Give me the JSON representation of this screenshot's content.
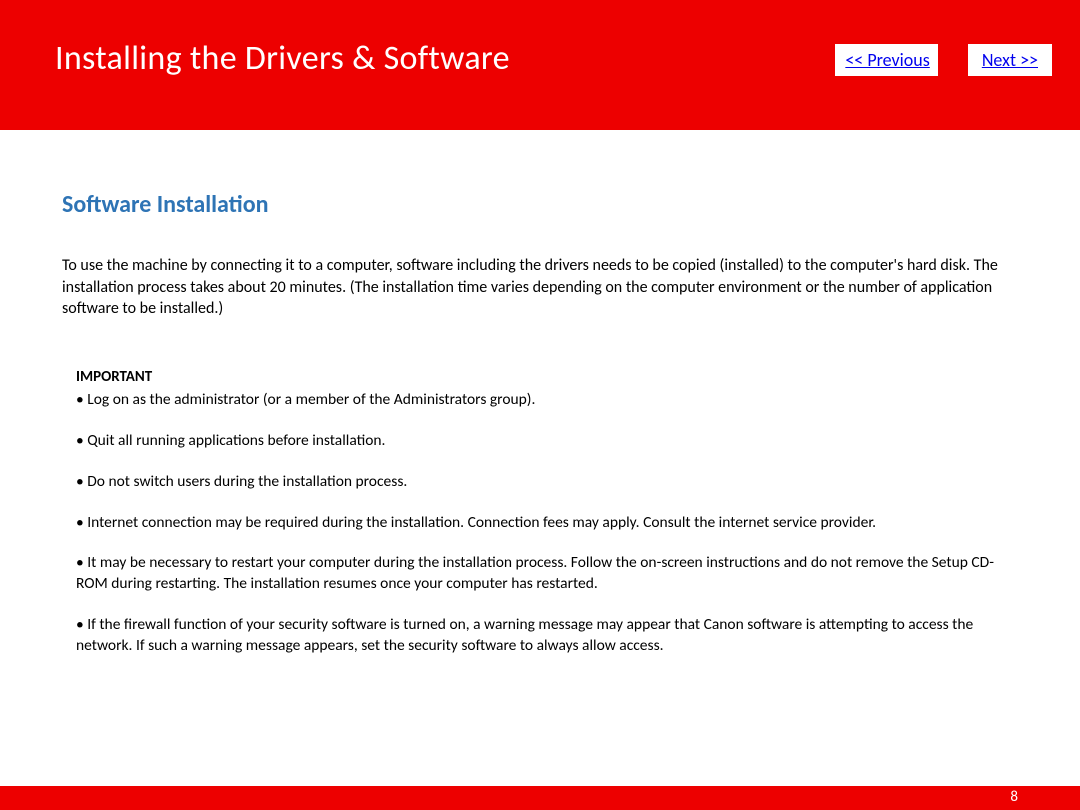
{
  "header": {
    "title": "Installing  the Drivers & Software",
    "prev_label": " << Previous",
    "next_label": "Next >>"
  },
  "content": {
    "subtitle": "Software Installation",
    "intro": "To use the machine by connecting it to a computer, software including the drivers needs to be copied (installed) to the computer's hard disk. The installation process takes about 20 minutes. (The installation time varies depending on the computer environment or the number of application software to be installed.)",
    "important_label": "IMPORTANT",
    "bullets": [
      "• Log on as the administrator (or a member of the Administrators group).",
      "• Quit all running applications before installation.",
      "• Do not switch users during the installation process.",
      "• Internet connection may be required during the installation. Connection fees may apply. Consult the internet service provider.",
      "• It may be necessary to restart your computer during the installation process. Follow the on-screen instructions and do not remove the Setup CD-ROM during restarting. The installation resumes once your computer has restarted.",
      "• If the firewall function of your security software is turned on, a warning message may appear that Canon software is attempting to access the network. If such a warning message appears, set the security software to always allow access."
    ]
  },
  "footer": {
    "page_number": "8"
  }
}
